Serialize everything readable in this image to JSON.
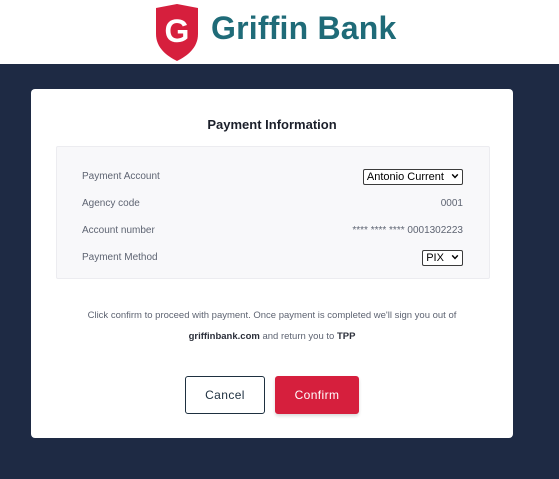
{
  "brand": {
    "name": "Griffin Bank",
    "logo_letter": "G",
    "colors": {
      "shield": "#d61f3d",
      "text": "#1f6b78",
      "page_bg": "#1e2a44"
    }
  },
  "card": {
    "title": "Payment Information",
    "rows": [
      {
        "label": "Payment Account",
        "value": "Antonio Current",
        "type": "select"
      },
      {
        "label": "Agency code",
        "value": "0001",
        "type": "text"
      },
      {
        "label": "Account number",
        "value": "**** **** **** 0001302223",
        "type": "text"
      },
      {
        "label": "Payment Method",
        "value": "PIX",
        "type": "select"
      }
    ],
    "notice": {
      "line1": "Click confirm to proceed with payment. Once payment is completed we'll sign you out of",
      "domain": "griffinbank.com",
      "mid": " and return you to ",
      "tpp": "TPP"
    },
    "buttons": {
      "cancel": "Cancel",
      "confirm": "Confirm"
    }
  }
}
